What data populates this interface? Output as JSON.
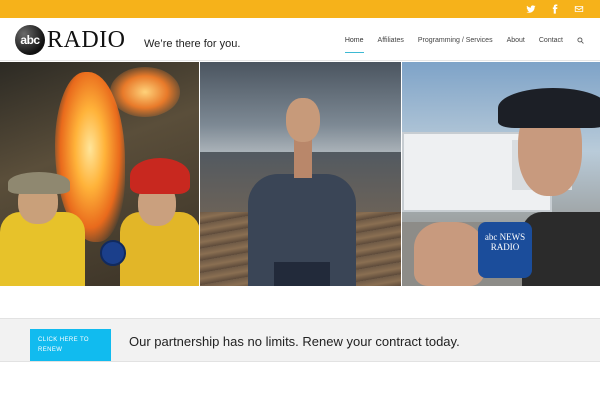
{
  "topbar": {
    "background": "#f6b21a",
    "social": [
      {
        "icon": "twitter-icon"
      },
      {
        "icon": "facebook-icon"
      },
      {
        "icon": "email-icon"
      }
    ]
  },
  "header": {
    "logo": {
      "mark_text": "abc",
      "word_text": "RADIO"
    },
    "tagline": "We’re there for you.",
    "nav": [
      {
        "label": "Home",
        "active": true
      },
      {
        "label": "Affiliates",
        "active": false
      },
      {
        "label": "Programming / Services",
        "active": false
      },
      {
        "label": "About",
        "active": false
      },
      {
        "label": "Contact",
        "active": false
      }
    ],
    "search_icon": "search-icon",
    "accent": "#3db9d3"
  },
  "hero": {
    "panels": [
      {
        "name": "fire-reporter-panel"
      },
      {
        "name": "storm-reporter-panel"
      },
      {
        "name": "field-reporter-panel",
        "mic_text": "abc NEWS RADIO"
      }
    ]
  },
  "cta": {
    "button_label": "CLICK HERE TO RENEW",
    "button_color": "#11bbef",
    "text": "Our partnership has no limits. Renew your contract today."
  }
}
